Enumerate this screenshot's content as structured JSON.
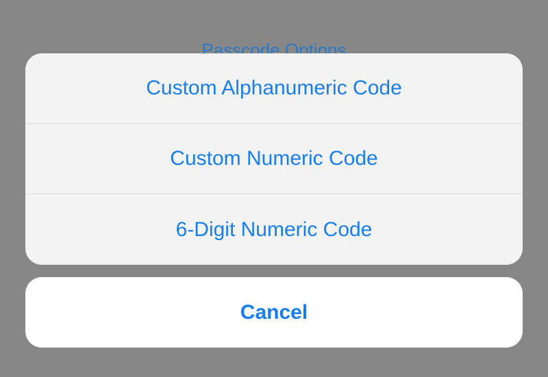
{
  "background": {
    "title": "Passcode Options"
  },
  "actionSheet": {
    "options": [
      {
        "label": "Custom Alphanumeric Code"
      },
      {
        "label": "Custom Numeric Code"
      },
      {
        "label": "6-Digit Numeric Code"
      }
    ],
    "cancel": "Cancel"
  }
}
